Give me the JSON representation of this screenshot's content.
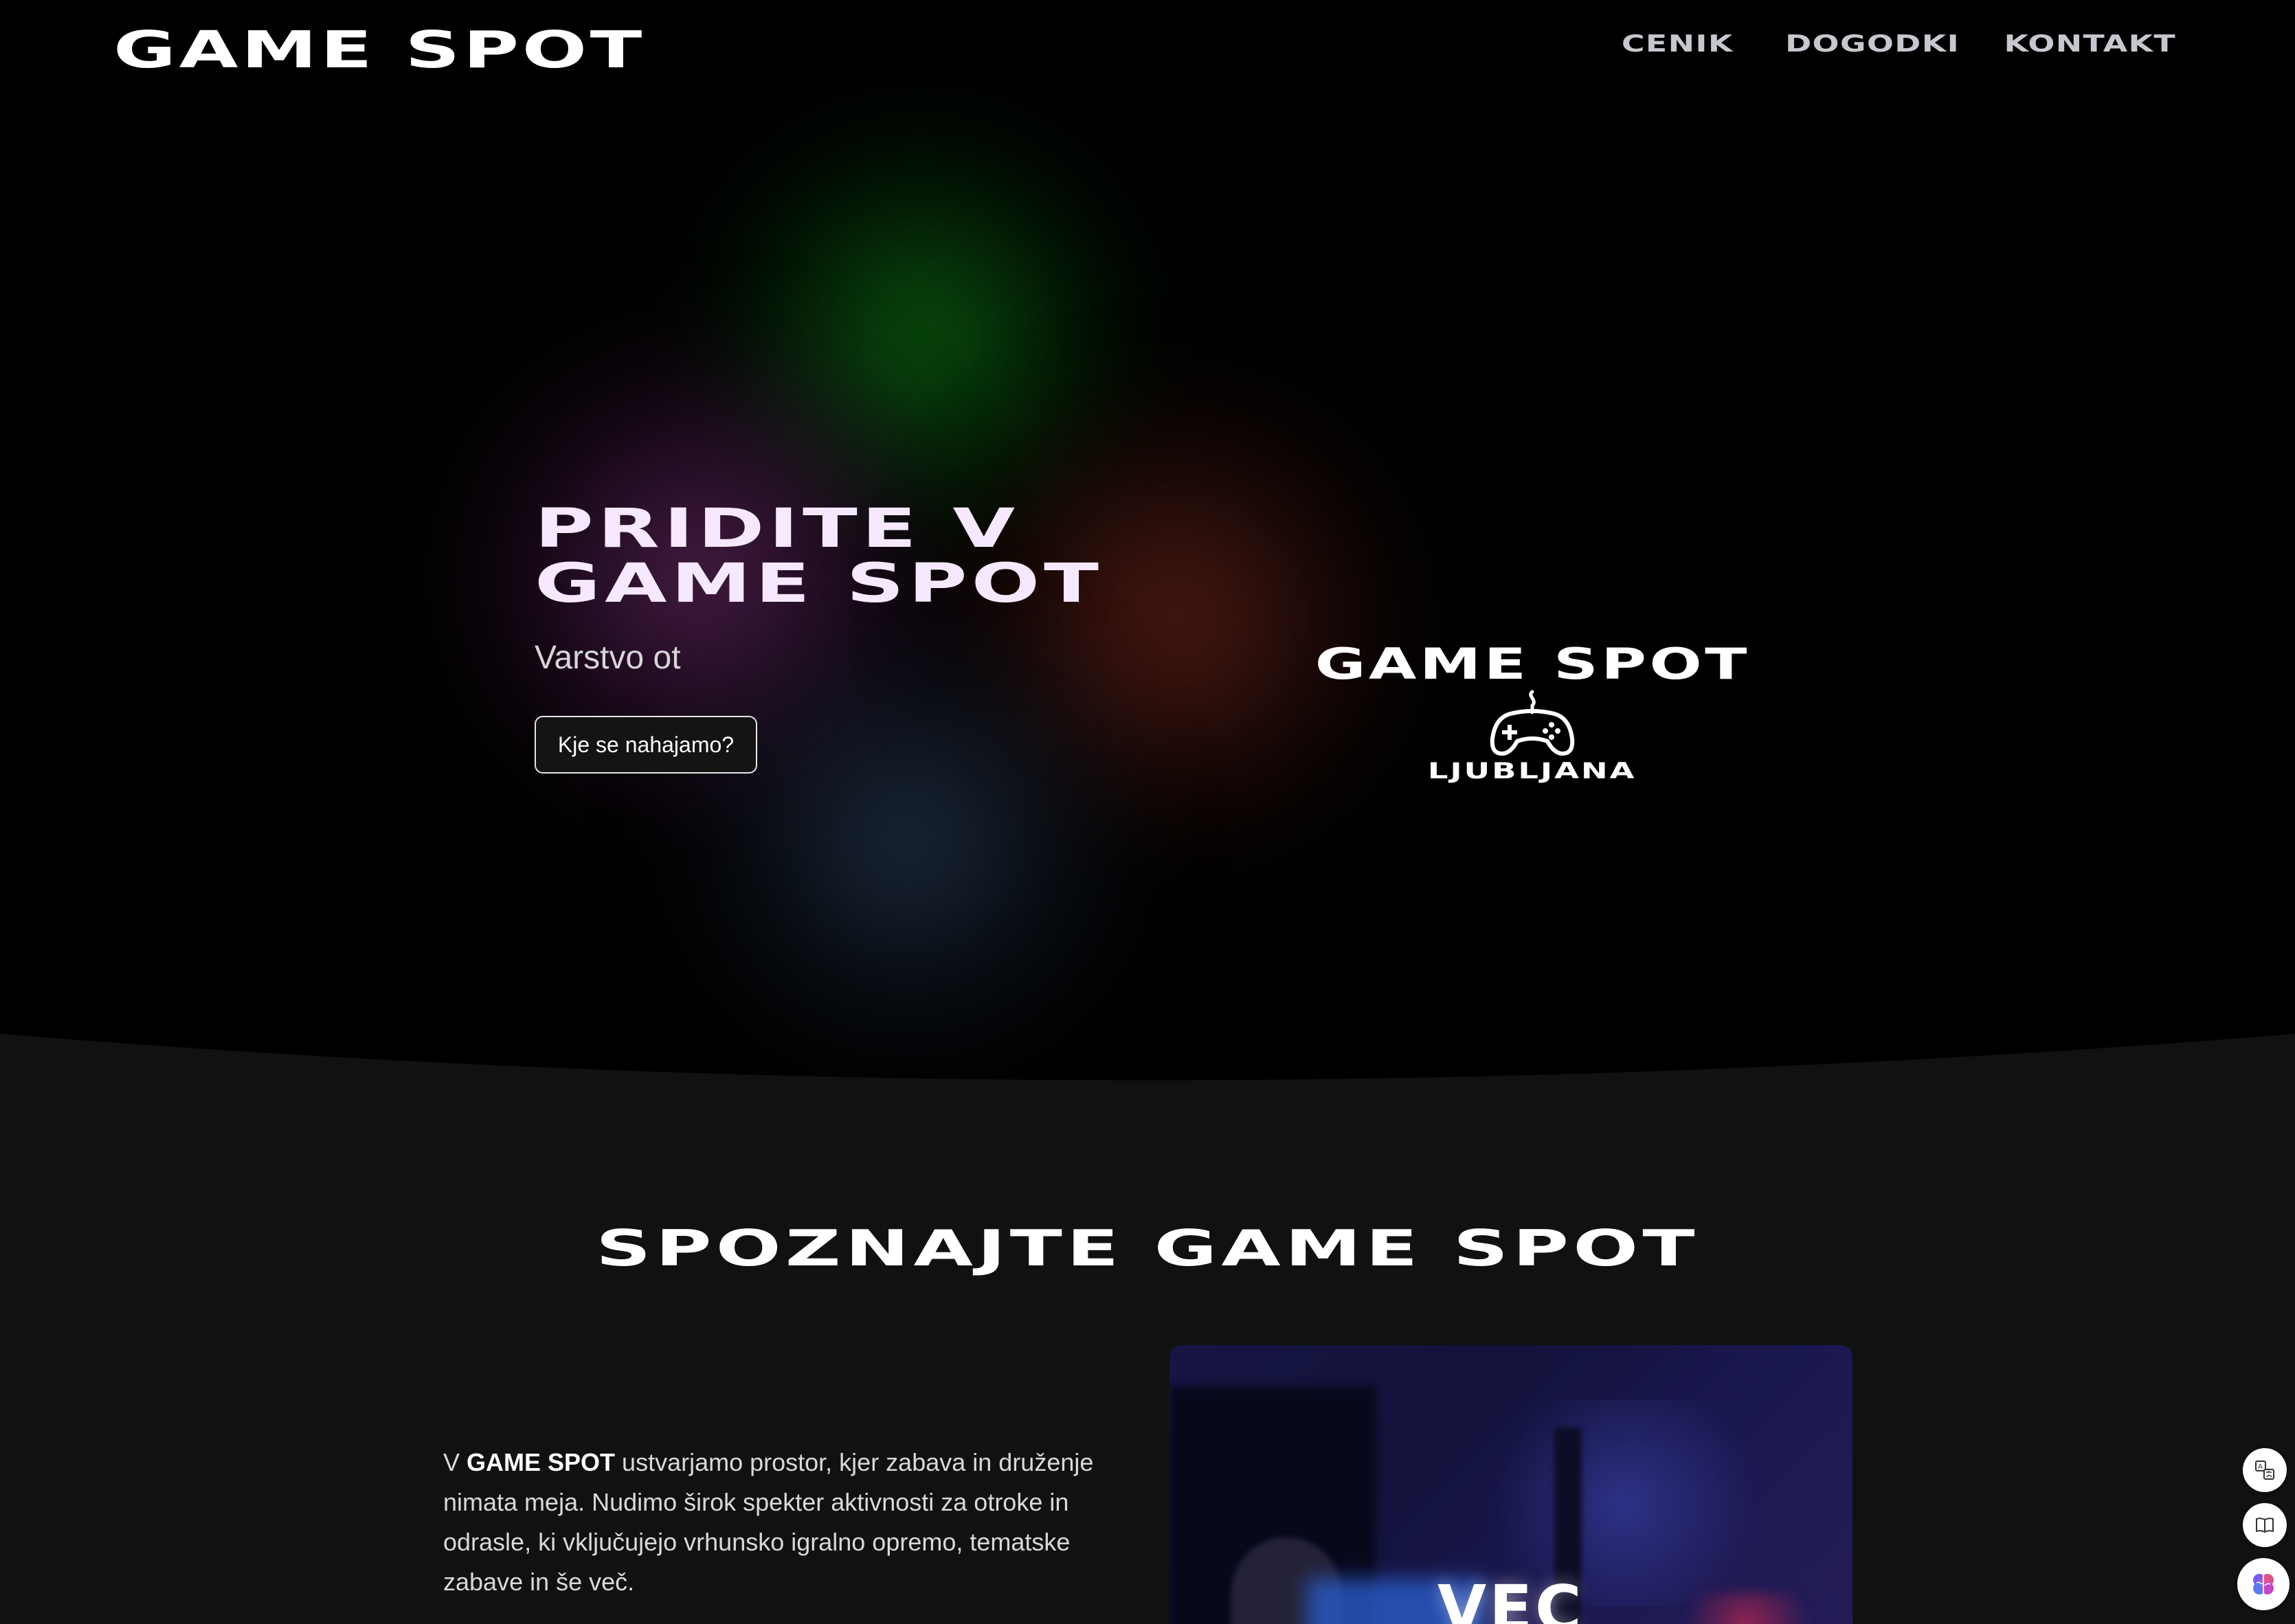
{
  "nav": {
    "brand": "GAME SPOT",
    "links": [
      {
        "label": "CENIK"
      },
      {
        "label": "DOGODKI"
      },
      {
        "label": "KONTAKT"
      }
    ]
  },
  "hero": {
    "title_line1": "PRIDITE V",
    "title_line2": "GAME SPOT",
    "subtitle": "Varstvo ot",
    "cta_label": "Kje se nahajamo?",
    "logo": {
      "title": "GAME SPOT",
      "city": "LJUBLJANA",
      "icon": "gamepad-icon"
    }
  },
  "about": {
    "title": "SPOZNAJTE GAME SPOT",
    "text_prefix": "V ",
    "text_bold": "GAME SPOT",
    "text_rest": " ustvarjamo prostor, kjer zabava in druženje nimata meja. Nudimo širok spekter aktivnosti za otroke in odrasle, ki vključujejo vrhunsko igralno opremo, tematske zabave in še več.",
    "image_overlay": "VEC"
  },
  "widgets": [
    {
      "icon": "translate-icon"
    },
    {
      "icon": "book-icon"
    },
    {
      "icon": "brain-icon"
    }
  ],
  "colors": {
    "background": "#000000",
    "section_background": "#111111",
    "nav_link": "#c5c8cf",
    "hero_title": "#f6e9ff"
  }
}
